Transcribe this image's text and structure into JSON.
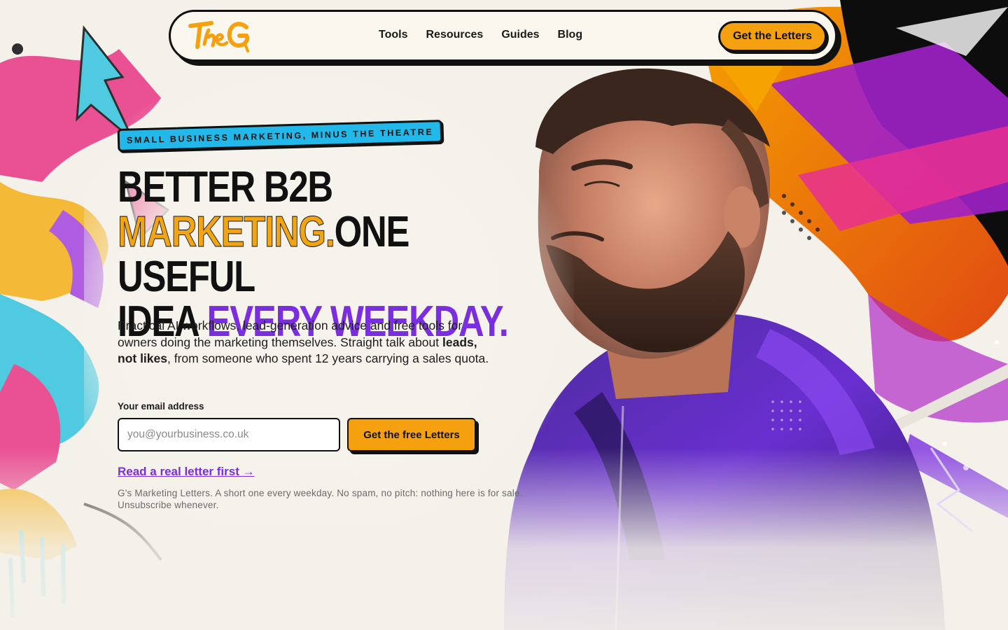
{
  "colors": {
    "accent_orange": "#f5a00f",
    "accent_purple": "#7a2ee0",
    "accent_blue": "#22b8ea",
    "ink": "#111111",
    "background": "#f4f1ea"
  },
  "nav": {
    "logo_text": "TheG",
    "links": [
      {
        "label": "Tools"
      },
      {
        "label": "Resources"
      },
      {
        "label": "Guides"
      },
      {
        "label": "Blog"
      }
    ],
    "cta_label": "Get the Letters"
  },
  "hero": {
    "eyebrow": "SMALL BUSINESS MARKETING, MINUS THE THEATRE",
    "headline": {
      "line1": "BETTER B2B",
      "highlight_orange": "MARKETING.",
      "line2_rest": "ONE USEFUL",
      "line3_start": "IDEA ",
      "highlight_purple": "EVERY WEEKDAY."
    },
    "lede": {
      "part1": "Practical AI workflows, lead-generation advice and free tools for owners doing the marketing themselves. Straight talk about ",
      "bold": "leads, not likes",
      "part2": ", from someone who spent 12 years carrying a sales quota."
    },
    "email_label": "Your email address",
    "email_placeholder": "you@yourbusiness.co.uk",
    "email_value": "",
    "submit_label": "Get the free Letters",
    "read_link": "Read a real letter first →",
    "fineprint": "G's Marketing Letters. A short one every weekday. No spam, no pitch: nothing here is for sale. Unsubscribe whenever."
  },
  "icons": [
    "logo-mark",
    "graffiti-art",
    "portrait-photo",
    "dot-grid-icon"
  ]
}
